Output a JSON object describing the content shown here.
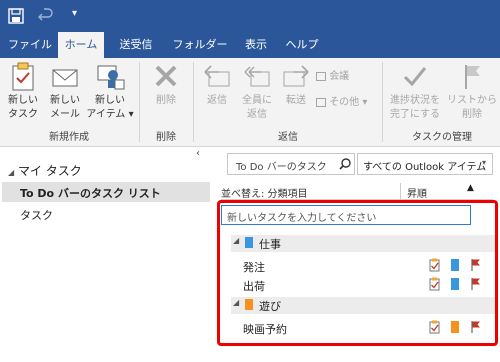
{
  "tabs": [
    "ファイル",
    "ホーム",
    "送受信",
    "フォルダー",
    "表示",
    "ヘルプ"
  ],
  "ribbon": {
    "new_task": [
      "新しい",
      "タスク"
    ],
    "new_mail": [
      "新しい",
      "メール"
    ],
    "new_item": [
      "新しい",
      "アイテム ▾"
    ],
    "group_new": "新規作成",
    "delete": "削除",
    "group_delete": "削除",
    "reply": "返信",
    "reply_all": [
      "全員に",
      "返信"
    ],
    "forward": "転送",
    "meeting": "会議",
    "more": "その他 ▾",
    "group_respond": "返信",
    "update_progress": [
      "進捗状況を",
      "完了にする"
    ],
    "remove_from_list": [
      "リストから",
      "削除"
    ],
    "group_manage": "タスクの管理"
  },
  "left": {
    "header": "マイ タスク",
    "items": [
      "To Do バーのタスク リスト",
      "タスク"
    ]
  },
  "search": {
    "placeholder": "To Do バーのタスク",
    "scope": "すべての Outlook アイテム"
  },
  "list": {
    "sort_label": "並べ替え: 分類項目",
    "order_label": "昇順",
    "new_task_placeholder": "新しいタスクを入力してください",
    "groups": [
      {
        "name": "仕事",
        "color": "#3a96dd",
        "tasks": [
          "発注",
          "出荷"
        ]
      },
      {
        "name": "遊び",
        "color": "#f7901e",
        "tasks": [
          "映画予約"
        ]
      }
    ]
  },
  "colors": {
    "accent": "#2b579a",
    "highlight": "#e00000",
    "flag": "#c0392b"
  }
}
